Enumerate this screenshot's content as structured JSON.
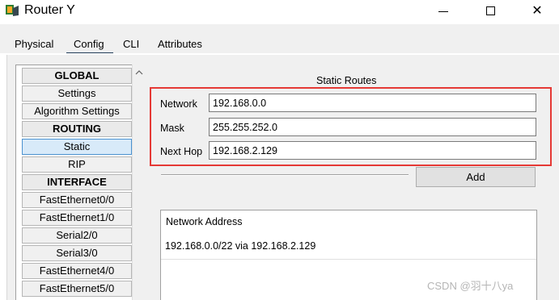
{
  "window": {
    "title": "Router Y",
    "controls": {
      "minimize": "minimize",
      "maximize": "maximize",
      "close": "✕"
    }
  },
  "tabs": [
    {
      "label": "Physical"
    },
    {
      "label": "Config",
      "active": true
    },
    {
      "label": "CLI"
    },
    {
      "label": "Attributes"
    }
  ],
  "sidebar": {
    "items": [
      {
        "label": "GLOBAL",
        "type": "header"
      },
      {
        "label": "Settings"
      },
      {
        "label": "Algorithm Settings"
      },
      {
        "label": "ROUTING",
        "type": "header"
      },
      {
        "label": "Static",
        "selected": true
      },
      {
        "label": "RIP"
      },
      {
        "label": "INTERFACE",
        "type": "header"
      },
      {
        "label": "FastEthernet0/0"
      },
      {
        "label": "FastEthernet1/0"
      },
      {
        "label": "Serial2/0"
      },
      {
        "label": "Serial3/0"
      },
      {
        "label": "FastEthernet4/0"
      },
      {
        "label": "FastEthernet5/0"
      }
    ],
    "scroll_up_icon": "chevron-up-icon"
  },
  "static_routes": {
    "title": "Static Routes",
    "network_label": "Network",
    "network_value": "192.168.0.0",
    "mask_label": "Mask",
    "mask_value": "255.255.252.0",
    "nexthop_label": "Next Hop",
    "nexthop_value": "192.168.2.129",
    "add_label": "Add",
    "list_header": "Network Address",
    "entries": [
      "192.168.0.0/22 via 192.168.2.129"
    ]
  },
  "watermark": "CSDN @羽十八ya",
  "colors": {
    "highlight": "#e53935",
    "selected": "#d8eaf9",
    "tab_underline": "#1f3b57"
  }
}
